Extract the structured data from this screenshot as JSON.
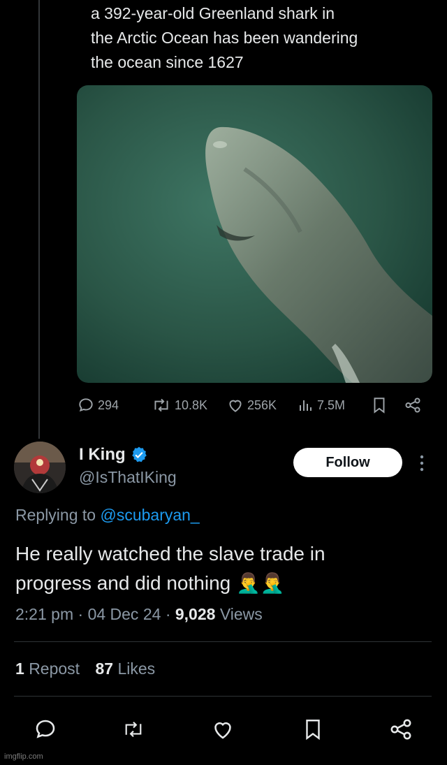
{
  "quoted_tweet": {
    "text_lines": [
      "a 392-year-old Greenland shark in",
      "the Arctic Ocean has been wandering",
      "the ocean since 1627"
    ],
    "media_alt": "greenland-shark-photo",
    "stats": {
      "replies": "294",
      "reposts": "10.8K",
      "likes": "256K",
      "views": "7.5M"
    }
  },
  "reply": {
    "display_name": "I King",
    "handle": "@IsThatIKing",
    "verified": true,
    "follow_label": "Follow",
    "replying_prefix": "Replying to",
    "replying_to": "@scubaryan_",
    "text_lines": [
      "He really watched the slave trade in",
      "progress and did nothing 🤦‍♂️🤦‍♂️"
    ],
    "time": "2:21 pm",
    "date": "04 Dec 24",
    "views_count": "9,028",
    "views_label": "Views",
    "reposts_count": "1",
    "reposts_label": "Repost",
    "likes_count": "87",
    "likes_label": "Likes"
  },
  "watermark": "imgflip.com",
  "colors": {
    "background": "#000000",
    "text": "#e7e9ea",
    "muted": "#8b98a5",
    "accent": "#1d9bf0",
    "divider": "#2f3336",
    "shark_water": "#2f5a4b"
  },
  "icons": [
    "reply-icon",
    "repost-icon",
    "like-icon",
    "views-icon",
    "bookmark-icon",
    "share-icon",
    "verified-badge-icon",
    "more-icon"
  ]
}
